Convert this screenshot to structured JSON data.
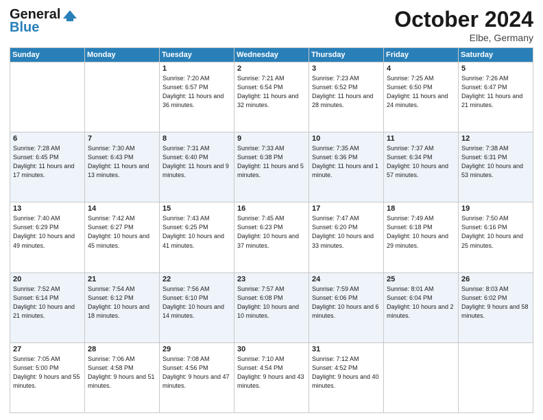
{
  "header": {
    "logo_line1": "General",
    "logo_line2": "Blue",
    "month": "October 2024",
    "location": "Elbe, Germany"
  },
  "days_of_week": [
    "Sunday",
    "Monday",
    "Tuesday",
    "Wednesday",
    "Thursday",
    "Friday",
    "Saturday"
  ],
  "weeks": [
    [
      {
        "day": "",
        "text": ""
      },
      {
        "day": "",
        "text": ""
      },
      {
        "day": "1",
        "text": "Sunrise: 7:20 AM\nSunset: 6:57 PM\nDaylight: 11 hours and 36 minutes."
      },
      {
        "day": "2",
        "text": "Sunrise: 7:21 AM\nSunset: 6:54 PM\nDaylight: 11 hours and 32 minutes."
      },
      {
        "day": "3",
        "text": "Sunrise: 7:23 AM\nSunset: 6:52 PM\nDaylight: 11 hours and 28 minutes."
      },
      {
        "day": "4",
        "text": "Sunrise: 7:25 AM\nSunset: 6:50 PM\nDaylight: 11 hours and 24 minutes."
      },
      {
        "day": "5",
        "text": "Sunrise: 7:26 AM\nSunset: 6:47 PM\nDaylight: 11 hours and 21 minutes."
      }
    ],
    [
      {
        "day": "6",
        "text": "Sunrise: 7:28 AM\nSunset: 6:45 PM\nDaylight: 11 hours and 17 minutes."
      },
      {
        "day": "7",
        "text": "Sunrise: 7:30 AM\nSunset: 6:43 PM\nDaylight: 11 hours and 13 minutes."
      },
      {
        "day": "8",
        "text": "Sunrise: 7:31 AM\nSunset: 6:40 PM\nDaylight: 11 hours and 9 minutes."
      },
      {
        "day": "9",
        "text": "Sunrise: 7:33 AM\nSunset: 6:38 PM\nDaylight: 11 hours and 5 minutes."
      },
      {
        "day": "10",
        "text": "Sunrise: 7:35 AM\nSunset: 6:36 PM\nDaylight: 11 hours and 1 minute."
      },
      {
        "day": "11",
        "text": "Sunrise: 7:37 AM\nSunset: 6:34 PM\nDaylight: 10 hours and 57 minutes."
      },
      {
        "day": "12",
        "text": "Sunrise: 7:38 AM\nSunset: 6:31 PM\nDaylight: 10 hours and 53 minutes."
      }
    ],
    [
      {
        "day": "13",
        "text": "Sunrise: 7:40 AM\nSunset: 6:29 PM\nDaylight: 10 hours and 49 minutes."
      },
      {
        "day": "14",
        "text": "Sunrise: 7:42 AM\nSunset: 6:27 PM\nDaylight: 10 hours and 45 minutes."
      },
      {
        "day": "15",
        "text": "Sunrise: 7:43 AM\nSunset: 6:25 PM\nDaylight: 10 hours and 41 minutes."
      },
      {
        "day": "16",
        "text": "Sunrise: 7:45 AM\nSunset: 6:23 PM\nDaylight: 10 hours and 37 minutes."
      },
      {
        "day": "17",
        "text": "Sunrise: 7:47 AM\nSunset: 6:20 PM\nDaylight: 10 hours and 33 minutes."
      },
      {
        "day": "18",
        "text": "Sunrise: 7:49 AM\nSunset: 6:18 PM\nDaylight: 10 hours and 29 minutes."
      },
      {
        "day": "19",
        "text": "Sunrise: 7:50 AM\nSunset: 6:16 PM\nDaylight: 10 hours and 25 minutes."
      }
    ],
    [
      {
        "day": "20",
        "text": "Sunrise: 7:52 AM\nSunset: 6:14 PM\nDaylight: 10 hours and 21 minutes."
      },
      {
        "day": "21",
        "text": "Sunrise: 7:54 AM\nSunset: 6:12 PM\nDaylight: 10 hours and 18 minutes."
      },
      {
        "day": "22",
        "text": "Sunrise: 7:56 AM\nSunset: 6:10 PM\nDaylight: 10 hours and 14 minutes."
      },
      {
        "day": "23",
        "text": "Sunrise: 7:57 AM\nSunset: 6:08 PM\nDaylight: 10 hours and 10 minutes."
      },
      {
        "day": "24",
        "text": "Sunrise: 7:59 AM\nSunset: 6:06 PM\nDaylight: 10 hours and 6 minutes."
      },
      {
        "day": "25",
        "text": "Sunrise: 8:01 AM\nSunset: 6:04 PM\nDaylight: 10 hours and 2 minutes."
      },
      {
        "day": "26",
        "text": "Sunrise: 8:03 AM\nSunset: 6:02 PM\nDaylight: 9 hours and 58 minutes."
      }
    ],
    [
      {
        "day": "27",
        "text": "Sunrise: 7:05 AM\nSunset: 5:00 PM\nDaylight: 9 hours and 55 minutes."
      },
      {
        "day": "28",
        "text": "Sunrise: 7:06 AM\nSunset: 4:58 PM\nDaylight: 9 hours and 51 minutes."
      },
      {
        "day": "29",
        "text": "Sunrise: 7:08 AM\nSunset: 4:56 PM\nDaylight: 9 hours and 47 minutes."
      },
      {
        "day": "30",
        "text": "Sunrise: 7:10 AM\nSunset: 4:54 PM\nDaylight: 9 hours and 43 minutes."
      },
      {
        "day": "31",
        "text": "Sunrise: 7:12 AM\nSunset: 4:52 PM\nDaylight: 9 hours and 40 minutes."
      },
      {
        "day": "",
        "text": ""
      },
      {
        "day": "",
        "text": ""
      }
    ]
  ]
}
